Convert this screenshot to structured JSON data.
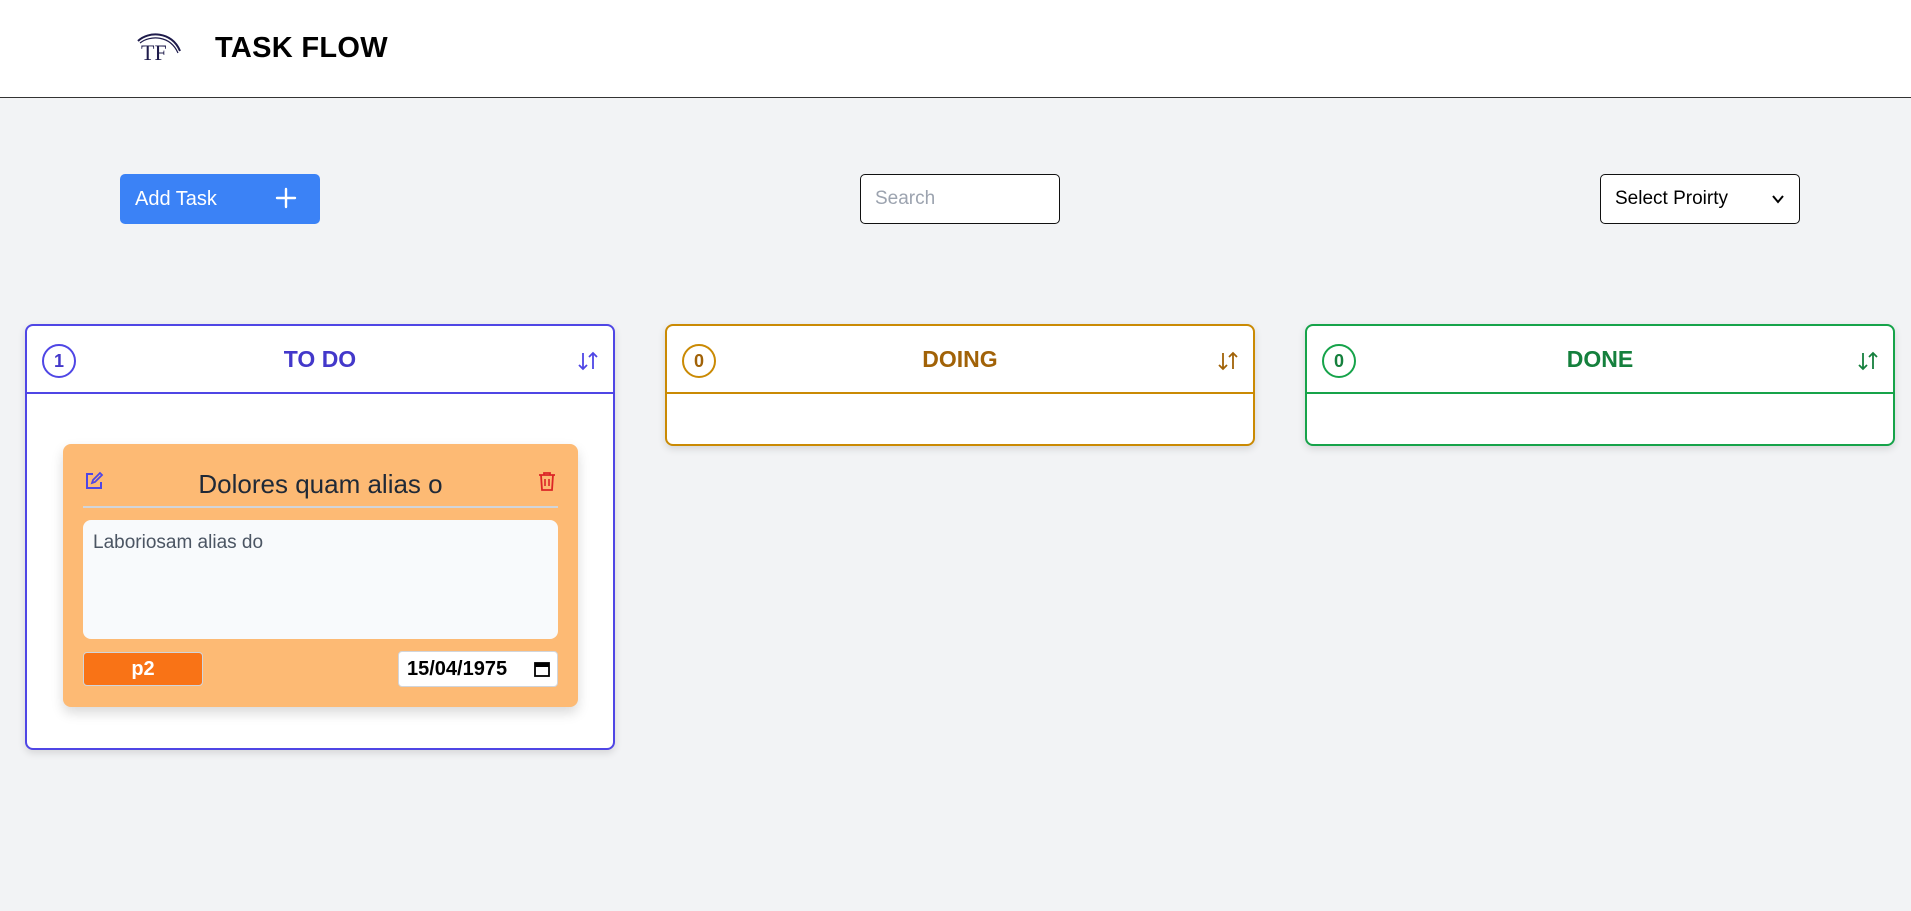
{
  "app": {
    "title": "TASK FLOW",
    "logo_text": "TF"
  },
  "toolbar": {
    "add_task_label": "Add Task",
    "add_icon": "plus-icon",
    "search_placeholder": "Search",
    "search_value": "",
    "priority_select_label": "Select Proirty"
  },
  "columns": [
    {
      "title": "TO DO",
      "count": "1",
      "color": "#4338ca"
    },
    {
      "title": "DOING",
      "count": "0",
      "color": "#a16207"
    },
    {
      "title": "DONE",
      "count": "0",
      "color": "#15803d"
    }
  ],
  "tasks": [
    {
      "title": "Dolores quam alias o",
      "description": "Laboriosam alias do",
      "priority": "p2",
      "date": "15/04/1975",
      "card_color": "#fdba74",
      "priority_color": "#f97316"
    }
  ],
  "icons": {
    "edit": "edit-icon",
    "delete": "trash-icon",
    "sort": "sort-arrows-icon",
    "calendar": "calendar-icon"
  }
}
